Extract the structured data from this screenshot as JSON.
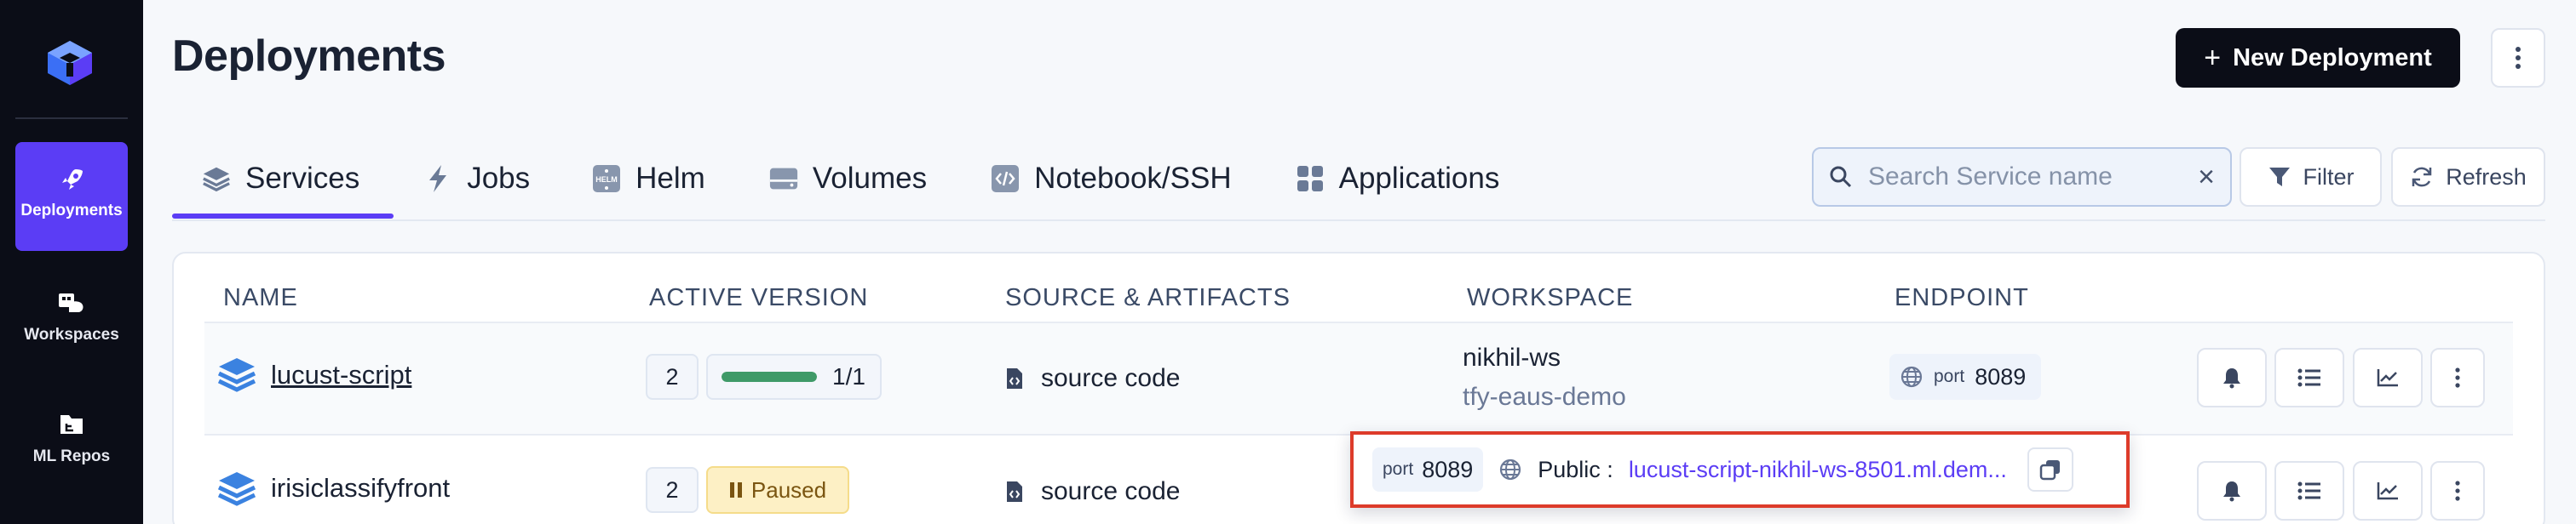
{
  "sidebar": {
    "logo": "truefoundry-cube-logo",
    "items": [
      {
        "label": "Deployments",
        "icon": "rocket-icon",
        "active": true
      },
      {
        "label": "Workspaces",
        "icon": "workspaces-icon",
        "active": false
      },
      {
        "label": "ML Repos",
        "icon": "folder-icon",
        "active": false
      }
    ]
  },
  "header": {
    "title": "Deployments",
    "new_button": "New Deployment",
    "new_icon": "+",
    "more_icon": "kebab-icon"
  },
  "tabs": [
    {
      "label": "Services",
      "icon": "layers-icon",
      "active": true
    },
    {
      "label": "Jobs",
      "icon": "lightning-icon",
      "active": false
    },
    {
      "label": "Helm",
      "icon": "helm-icon",
      "active": false
    },
    {
      "label": "Volumes",
      "icon": "volume-icon",
      "active": false
    },
    {
      "label": "Notebook/SSH",
      "icon": "code-icon",
      "active": false
    },
    {
      "label": "Applications",
      "icon": "grid-icon",
      "active": false
    }
  ],
  "toolbar": {
    "search_placeholder": "Search Service name",
    "clear_icon": "×",
    "filter_label": "Filter",
    "refresh_label": "Refresh"
  },
  "table": {
    "columns": [
      "NAME",
      "ACTIVE VERSION",
      "SOURCE & ARTIFACTS",
      "WORKSPACE",
      "ENDPOINT"
    ],
    "rows": [
      {
        "name": "lucust-script",
        "version": "2",
        "replicas": "1/1",
        "replica_progress": 1.0,
        "source": "source code",
        "workspace": "nikhil-ws",
        "cluster": "tfy-eaus-demo",
        "port_label": "port",
        "port": "8089"
      },
      {
        "name": "irisiclassifyfront",
        "version": "2",
        "status": "Paused",
        "source": "source code"
      }
    ]
  },
  "popup": {
    "port_label": "port",
    "port": "8089",
    "visibility": "Public :",
    "url": "lucust-script-nikhil-ws-8501.ml.dem..."
  },
  "colors": {
    "accent": "#5b3df5",
    "sidebar_bg": "#0b0d17",
    "success": "#3f9a68",
    "paused_bg": "#fdf0c5",
    "highlight": "#dd3b2a"
  }
}
